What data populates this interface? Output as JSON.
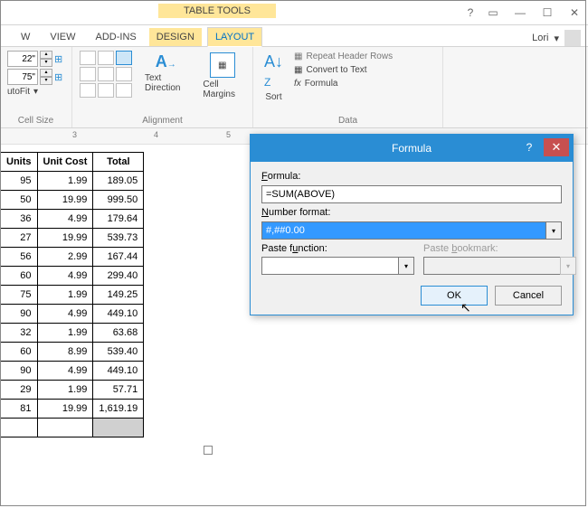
{
  "window": {
    "table_tools": "TABLE TOOLS",
    "user": "Lori"
  },
  "tabs": {
    "partial1": "W",
    "view": "View",
    "addins": "ADD-INS",
    "design": "DESIGN",
    "layout": "LAYOUT"
  },
  "ribbon": {
    "height_val": "22\"",
    "width_val": "75\"",
    "autofit": "utoFit",
    "cellsize": "Cell Size",
    "alignment": "Alignment",
    "text_direction": "Text Direction",
    "cell_margins": "Cell Margins",
    "sort": "Sort",
    "repeat_header": "Repeat Header Rows",
    "convert_text": "Convert to Text",
    "formula": "Formula",
    "data": "Data"
  },
  "ruler": {
    "m3": "3",
    "m4": "4",
    "m5": "5"
  },
  "table": {
    "headers": [
      "Units",
      "Unit Cost",
      "Total"
    ],
    "rows": [
      [
        "95",
        "1.99",
        "189.05"
      ],
      [
        "50",
        "19.99",
        "999.50"
      ],
      [
        "36",
        "4.99",
        "179.64"
      ],
      [
        "27",
        "19.99",
        "539.73"
      ],
      [
        "56",
        "2.99",
        "167.44"
      ],
      [
        "60",
        "4.99",
        "299.40"
      ],
      [
        "75",
        "1.99",
        "149.25"
      ],
      [
        "90",
        "4.99",
        "449.10"
      ],
      [
        "32",
        "1.99",
        "63.68"
      ],
      [
        "60",
        "8.99",
        "539.40"
      ],
      [
        "90",
        "4.99",
        "449.10"
      ],
      [
        "29",
        "1.99",
        "57.71"
      ],
      [
        "81",
        "19.99",
        "1,619.19"
      ]
    ]
  },
  "dialog": {
    "title": "Formula",
    "formula_label": "Formula:",
    "formula_value": "=SUM(ABOVE)",
    "numfmt_label": "Number format:",
    "numfmt_value": "#,##0.00",
    "paste_fn": "Paste function:",
    "paste_bm": "Paste bookmark:",
    "ok": "OK",
    "cancel": "Cancel"
  }
}
